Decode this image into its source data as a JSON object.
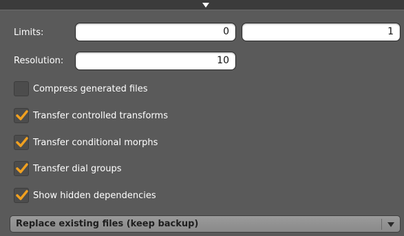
{
  "limits": {
    "label": "Limits:",
    "min_value": "0",
    "max_value": "1"
  },
  "resolution": {
    "label": "Resolution:",
    "value": "10"
  },
  "options": [
    {
      "label": "Compress generated files",
      "checked": false
    },
    {
      "label": "Transfer controlled transforms",
      "checked": true
    },
    {
      "label": "Transfer conditional morphs",
      "checked": true
    },
    {
      "label": "Transfer dial groups",
      "checked": true
    },
    {
      "label": "Show hidden dependencies",
      "checked": true
    }
  ],
  "file_mode": {
    "selected": "Replace existing files (keep backup)"
  },
  "colors": {
    "panel_bg": "#5a5a5a",
    "check_accent": "#f0a020"
  }
}
